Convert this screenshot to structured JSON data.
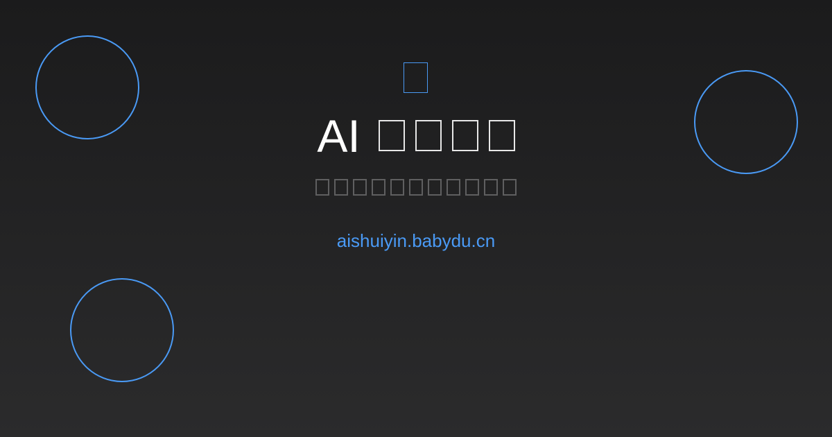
{
  "logo": {
    "icon": "app-logo-icon",
    "color": "#4a9af5"
  },
  "title": {
    "prefix": "AI"
  },
  "domain": {
    "text": "aishuiyin.babydu.cn"
  },
  "colors": {
    "accent": "#4a9af5",
    "title_text": "#ffffff",
    "subtitle_text": "#5f5f60",
    "background": "#1b1b1c"
  }
}
